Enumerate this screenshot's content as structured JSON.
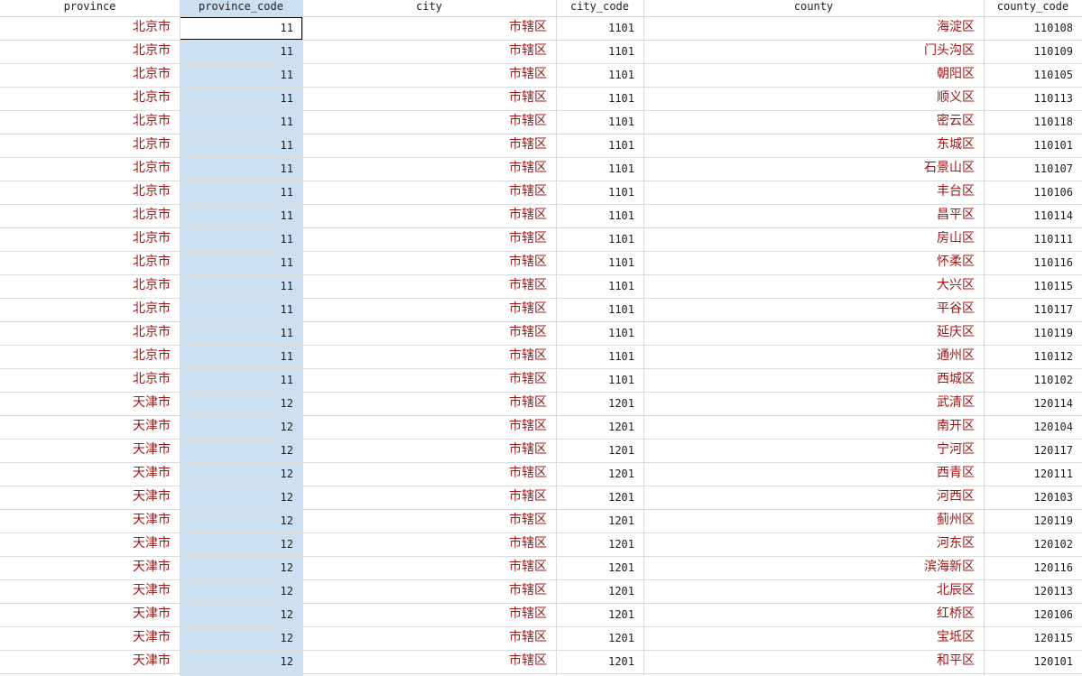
{
  "columns": [
    {
      "key": "province",
      "label": "province",
      "kind": "text"
    },
    {
      "key": "province_code",
      "label": "province_code",
      "kind": "num"
    },
    {
      "key": "city",
      "label": "city",
      "kind": "text"
    },
    {
      "key": "city_code",
      "label": "city_code",
      "kind": "num"
    },
    {
      "key": "county",
      "label": "county",
      "kind": "text"
    },
    {
      "key": "county_code",
      "label": "county_code",
      "kind": "num"
    }
  ],
  "selected_column": "province_code",
  "active_cell": {
    "row": 0,
    "column": "province_code"
  },
  "colors": {
    "text_value": "#a41515",
    "numeric_value": "#1e1e1e",
    "selection": "#cde0f1"
  },
  "rows": [
    {
      "province": "北京市",
      "province_code": "11",
      "city": "市辖区",
      "city_code": "1101",
      "county": "海淀区",
      "county_code": "110108"
    },
    {
      "province": "北京市",
      "province_code": "11",
      "city": "市辖区",
      "city_code": "1101",
      "county": "门头沟区",
      "county_code": "110109"
    },
    {
      "province": "北京市",
      "province_code": "11",
      "city": "市辖区",
      "city_code": "1101",
      "county": "朝阳区",
      "county_code": "110105"
    },
    {
      "province": "北京市",
      "province_code": "11",
      "city": "市辖区",
      "city_code": "1101",
      "county": "顺义区",
      "county_code": "110113"
    },
    {
      "province": "北京市",
      "province_code": "11",
      "city": "市辖区",
      "city_code": "1101",
      "county": "密云区",
      "county_code": "110118"
    },
    {
      "province": "北京市",
      "province_code": "11",
      "city": "市辖区",
      "city_code": "1101",
      "county": "东城区",
      "county_code": "110101"
    },
    {
      "province": "北京市",
      "province_code": "11",
      "city": "市辖区",
      "city_code": "1101",
      "county": "石景山区",
      "county_code": "110107"
    },
    {
      "province": "北京市",
      "province_code": "11",
      "city": "市辖区",
      "city_code": "1101",
      "county": "丰台区",
      "county_code": "110106"
    },
    {
      "province": "北京市",
      "province_code": "11",
      "city": "市辖区",
      "city_code": "1101",
      "county": "昌平区",
      "county_code": "110114"
    },
    {
      "province": "北京市",
      "province_code": "11",
      "city": "市辖区",
      "city_code": "1101",
      "county": "房山区",
      "county_code": "110111"
    },
    {
      "province": "北京市",
      "province_code": "11",
      "city": "市辖区",
      "city_code": "1101",
      "county": "怀柔区",
      "county_code": "110116"
    },
    {
      "province": "北京市",
      "province_code": "11",
      "city": "市辖区",
      "city_code": "1101",
      "county": "大兴区",
      "county_code": "110115"
    },
    {
      "province": "北京市",
      "province_code": "11",
      "city": "市辖区",
      "city_code": "1101",
      "county": "平谷区",
      "county_code": "110117"
    },
    {
      "province": "北京市",
      "province_code": "11",
      "city": "市辖区",
      "city_code": "1101",
      "county": "延庆区",
      "county_code": "110119"
    },
    {
      "province": "北京市",
      "province_code": "11",
      "city": "市辖区",
      "city_code": "1101",
      "county": "通州区",
      "county_code": "110112"
    },
    {
      "province": "北京市",
      "province_code": "11",
      "city": "市辖区",
      "city_code": "1101",
      "county": "西城区",
      "county_code": "110102"
    },
    {
      "province": "天津市",
      "province_code": "12",
      "city": "市辖区",
      "city_code": "1201",
      "county": "武清区",
      "county_code": "120114"
    },
    {
      "province": "天津市",
      "province_code": "12",
      "city": "市辖区",
      "city_code": "1201",
      "county": "南开区",
      "county_code": "120104"
    },
    {
      "province": "天津市",
      "province_code": "12",
      "city": "市辖区",
      "city_code": "1201",
      "county": "宁河区",
      "county_code": "120117"
    },
    {
      "province": "天津市",
      "province_code": "12",
      "city": "市辖区",
      "city_code": "1201",
      "county": "西青区",
      "county_code": "120111"
    },
    {
      "province": "天津市",
      "province_code": "12",
      "city": "市辖区",
      "city_code": "1201",
      "county": "河西区",
      "county_code": "120103"
    },
    {
      "province": "天津市",
      "province_code": "12",
      "city": "市辖区",
      "city_code": "1201",
      "county": "蓟州区",
      "county_code": "120119"
    },
    {
      "province": "天津市",
      "province_code": "12",
      "city": "市辖区",
      "city_code": "1201",
      "county": "河东区",
      "county_code": "120102"
    },
    {
      "province": "天津市",
      "province_code": "12",
      "city": "市辖区",
      "city_code": "1201",
      "county": "滨海新区",
      "county_code": "120116"
    },
    {
      "province": "天津市",
      "province_code": "12",
      "city": "市辖区",
      "city_code": "1201",
      "county": "北辰区",
      "county_code": "120113"
    },
    {
      "province": "天津市",
      "province_code": "12",
      "city": "市辖区",
      "city_code": "1201",
      "county": "红桥区",
      "county_code": "120106"
    },
    {
      "province": "天津市",
      "province_code": "12",
      "city": "市辖区",
      "city_code": "1201",
      "county": "宝坻区",
      "county_code": "120115"
    },
    {
      "province": "天津市",
      "province_code": "12",
      "city": "市辖区",
      "city_code": "1201",
      "county": "和平区",
      "county_code": "120101"
    }
  ]
}
